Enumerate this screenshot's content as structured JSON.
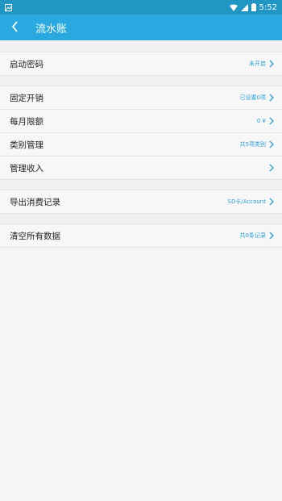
{
  "status_bar": {
    "time": "5:52"
  },
  "app_bar": {
    "title": "流水账"
  },
  "groups": [
    [
      {
        "label": "启动密码",
        "value": "未开启"
      }
    ],
    [
      {
        "label": "固定开销",
        "value": "已设置0项"
      },
      {
        "label": "每月限额",
        "value": "0 ¥"
      },
      {
        "label": "类别管理",
        "value": "共5项类别"
      },
      {
        "label": "管理收入",
        "value": ""
      }
    ],
    [
      {
        "label": "导出消费记录",
        "value": "SD卡/Account"
      }
    ],
    [
      {
        "label": "清空所有数据",
        "value": "共0条记录"
      }
    ]
  ],
  "colors": {
    "accent": "#29a9df",
    "status_bar": "#1f96c4",
    "value_text": "#2a9fd6"
  }
}
